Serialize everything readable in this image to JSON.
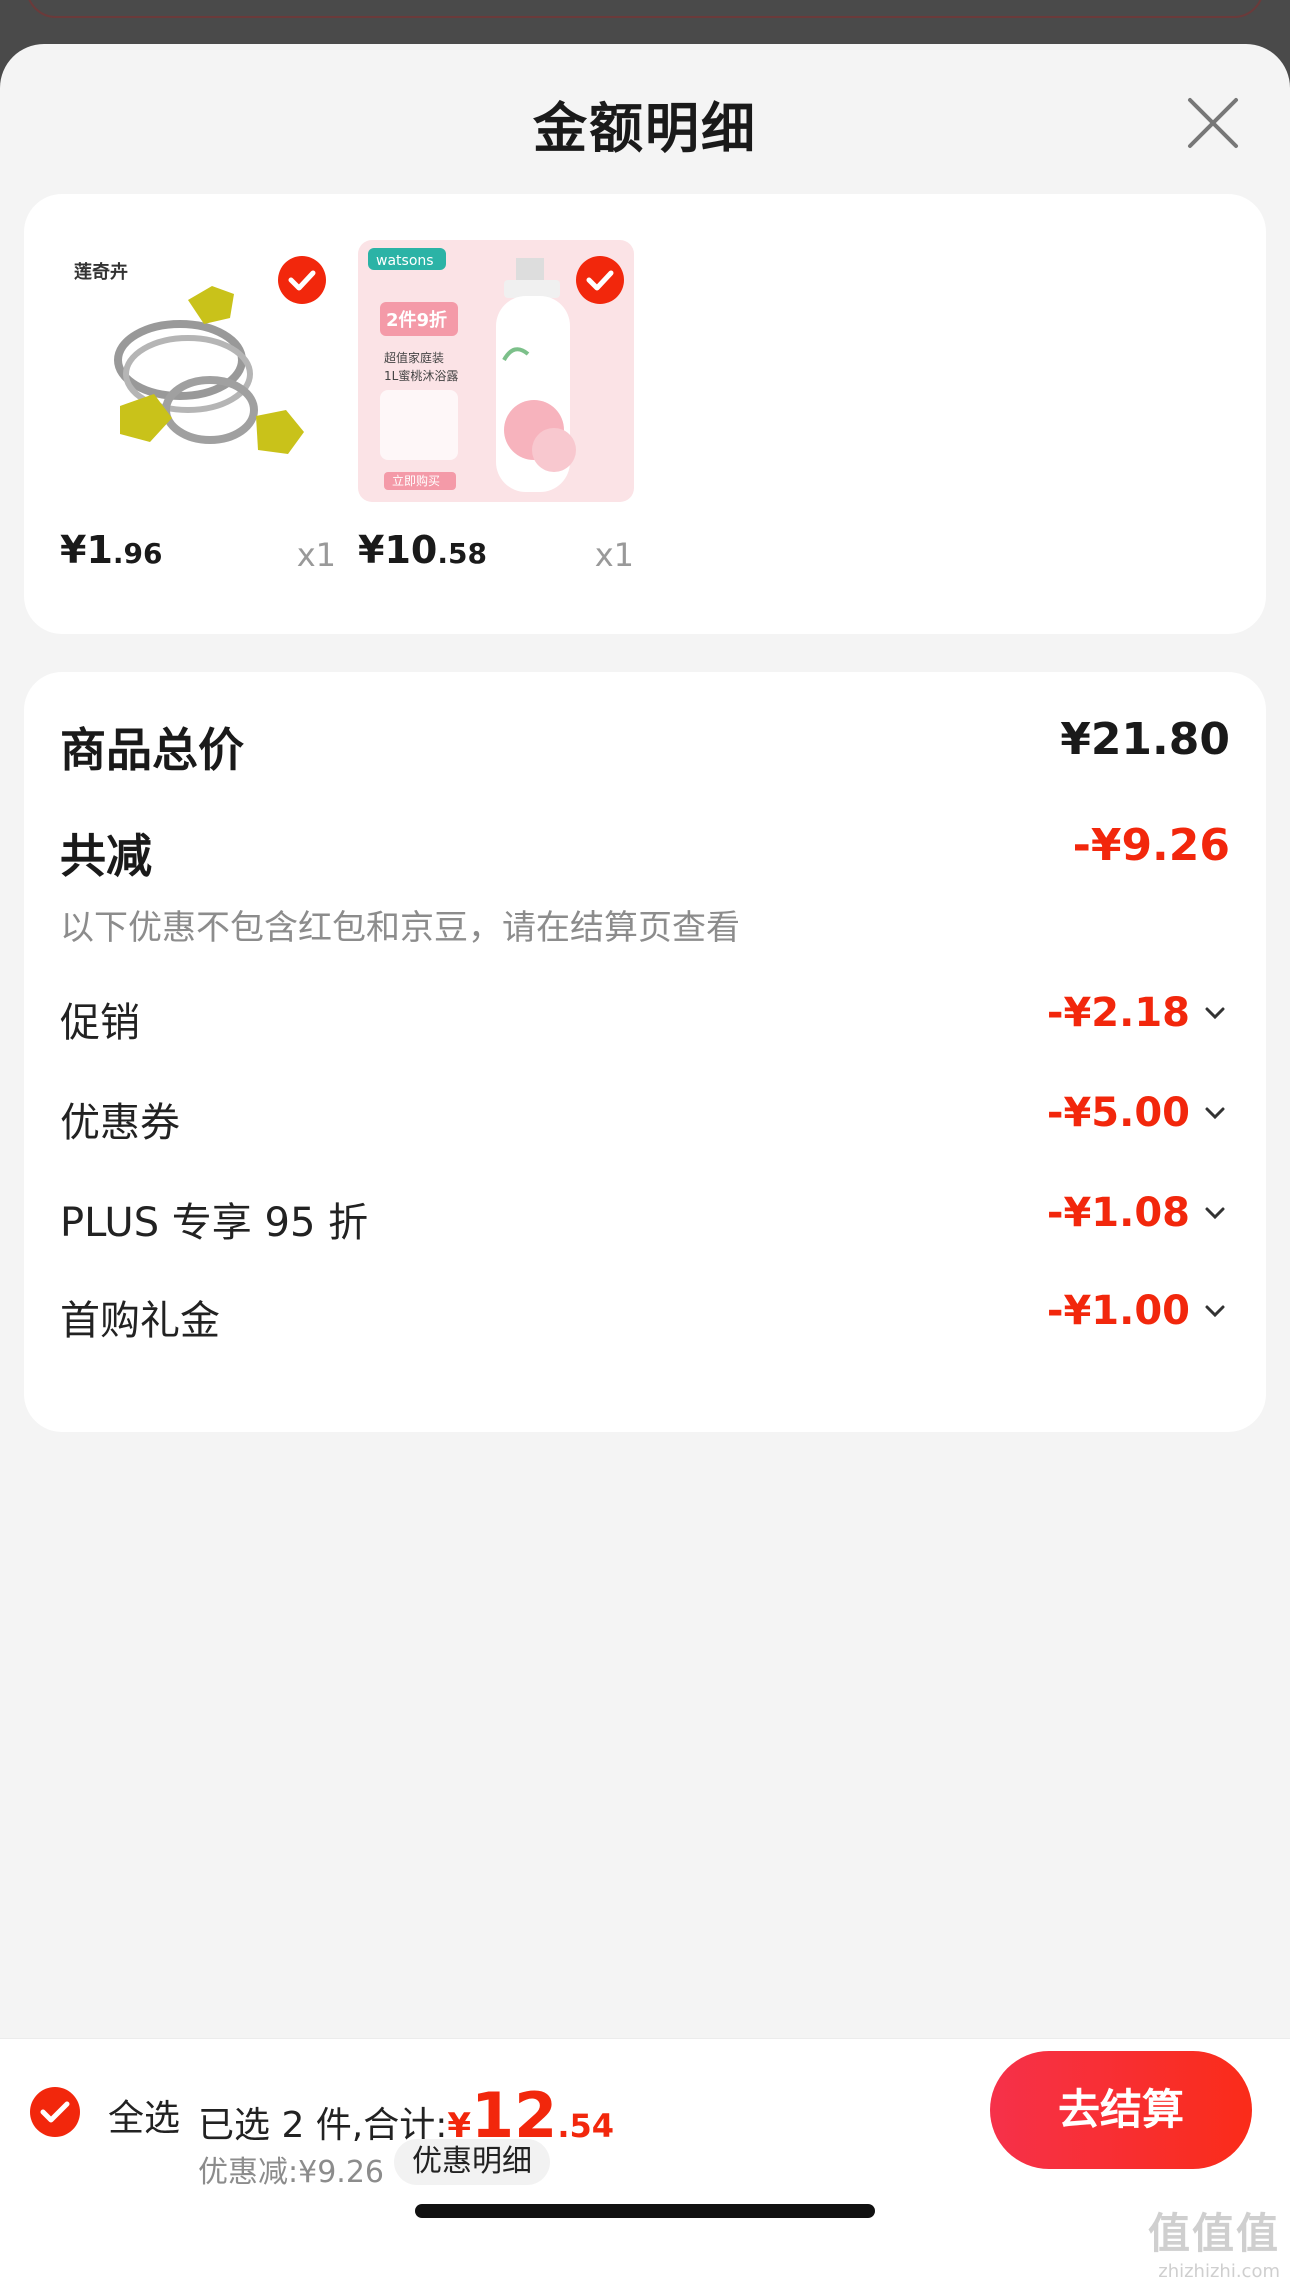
{
  "sheet": {
    "title": "金额明细"
  },
  "products": [
    {
      "brand_logo": "莲奇卉",
      "price_int": "¥1",
      "price_dec": ".96",
      "qty": "x1",
      "checked": true
    },
    {
      "brand_logo": "watsons",
      "promo_text": "2件9折",
      "promo_sub": "超值家庭装",
      "promo_sub2": "1L蜜桃沐浴露",
      "buy_now": "立即购买",
      "price_int": "¥10",
      "price_dec": ".58",
      "qty": "x1",
      "checked": true
    }
  ],
  "summary": {
    "total_label": "商品总价",
    "total_value": "¥21.80",
    "reduce_label": "共减",
    "reduce_value": "-¥9.26",
    "note": "以下优惠不包含红包和京豆，请在结算页查看",
    "items": [
      {
        "label": "促销",
        "value": "-¥2.18"
      },
      {
        "label": "优惠券",
        "value": "-¥5.00"
      },
      {
        "label": "PLUS 专享 95 折",
        "value": "-¥1.08"
      },
      {
        "label": "首购礼金",
        "value": "-¥1.00"
      }
    ]
  },
  "bottom": {
    "select_all": "全选",
    "selected_prefix": "已选 2 件,合计:",
    "total_symbol": "¥",
    "total_int": "12",
    "total_dec": ".54",
    "discount": "优惠减:¥9.26",
    "detail_chip": "优惠明细",
    "checkout": "去结算"
  },
  "watermark": {
    "main": "值值值",
    "sub": "zhizhizhi.com"
  },
  "colors": {
    "accent": "#f2270c",
    "checkout_start": "#f6314a",
    "sheet_bg": "#f4f4f4"
  }
}
